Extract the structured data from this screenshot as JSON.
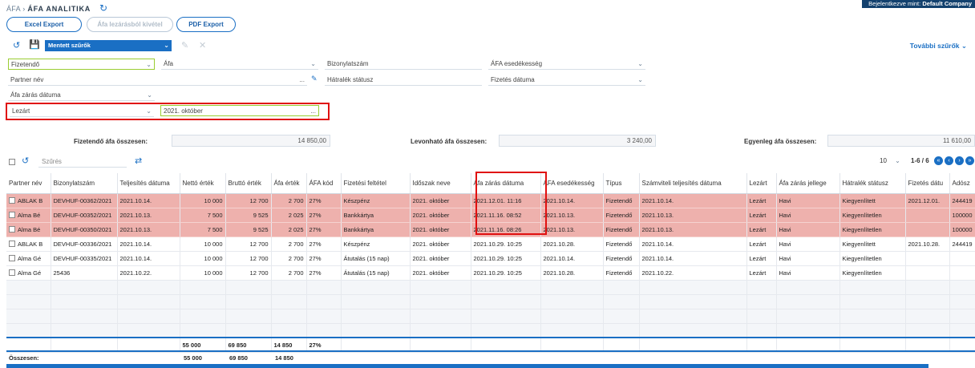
{
  "breadcrumb": {
    "parent": "ÁFA",
    "sep": "›",
    "title": "ÁFA ANALITIKA"
  },
  "login": {
    "prefix": "Bejelentkezve mint:",
    "company": "Default Company"
  },
  "toolbar": {
    "excel": "Excel Export",
    "remove": "Áfa lezárásból kivétel",
    "pdf": "PDF Export"
  },
  "saved_filters": "Mentett szűrők",
  "more_filters": "További szűrők",
  "filters": {
    "fizetendo": "Fizetendő",
    "afa": "Áfa",
    "bizonylatszam": "Bizonylatszám",
    "afa_esedekesseg": "ÁFA esedékesség",
    "partner_nev": "Partner név",
    "hatralek": "Hátralék státusz",
    "fizetes_datuma": "Fizetés dátuma",
    "afa_zaras_datuma": "Áfa zárás dátuma",
    "lezart": "Lezárt",
    "period": "2021. október",
    "dots": "..."
  },
  "totals": {
    "fizetendo_label": "Fizetendő áfa összesen:",
    "fizetendo_value": "14 850,00",
    "levonhato_label": "Levonható áfa összesen:",
    "levonhato_value": "3 240,00",
    "egyenleg_label": "Egyenleg áfa összesen:",
    "egyenleg_value": "11 610,00"
  },
  "search_placeholder": "Szűrés",
  "pager": {
    "page_size": "10",
    "range": "1-6 / 6"
  },
  "columns": [
    "Partner név",
    "Bizonylatszám",
    "Teljesítés dátuma",
    "Nettó érték",
    "Bruttó érték",
    "Áfa érték",
    "ÁFA kód",
    "Fizetési feltétel",
    "Időszak neve",
    "Áfa zárás dátuma",
    "ÁFA esedékesség",
    "Típus",
    "Számviteli teljesítés dátuma",
    "Lezárt",
    "Áfa zárás jellege",
    "Hátralék státusz",
    "Fizetés dátu",
    "Adósz"
  ],
  "rows": [
    [
      "ABLAK B",
      "DEVHUF-00362/2021",
      "2021.10.14.",
      "10 000",
      "12 700",
      "2 700",
      "27%",
      "Készpénz",
      "2021. október",
      "2021.12.01. 11:16",
      "2021.10.14.",
      "Fizetendő",
      "2021.10.14.",
      "Lezárt",
      "Havi",
      "Kiegyenlített",
      "2021.12.01.",
      "244419"
    ],
    [
      "Alma Bé",
      "DEVHUF-00352/2021",
      "2021.10.13.",
      "7 500",
      "9 525",
      "2 025",
      "27%",
      "Bankkártya",
      "2021. október",
      "2021.11.16. 08:52",
      "2021.10.13.",
      "Fizetendő",
      "2021.10.13.",
      "Lezárt",
      "Havi",
      "Kiegyenlítetlen",
      "",
      "100000"
    ],
    [
      "Alma Bé",
      "DEVHUF-00350/2021",
      "2021.10.13.",
      "7 500",
      "9 525",
      "2 025",
      "27%",
      "Bankkártya",
      "2021. október",
      "2021.11.16. 08:26",
      "2021.10.13.",
      "Fizetendő",
      "2021.10.13.",
      "Lezárt",
      "Havi",
      "Kiegyenlítetlen",
      "",
      "100000"
    ],
    [
      "ABLAK B",
      "DEVHUF-00336/2021",
      "2021.10.14.",
      "10 000",
      "12 700",
      "2 700",
      "27%",
      "Készpénz",
      "2021. október",
      "2021.10.29. 10:25",
      "2021.10.28.",
      "Fizetendő",
      "2021.10.14.",
      "Lezárt",
      "Havi",
      "Kiegyenlített",
      "2021.10.28.",
      "244419"
    ],
    [
      "Alma Gé",
      "DEVHUF-00335/2021",
      "2021.10.14.",
      "10 000",
      "12 700",
      "2 700",
      "27%",
      "Átutalás (15 nap)",
      "2021. október",
      "2021.10.29. 10:25",
      "2021.10.14.",
      "Fizetendő",
      "2021.10.14.",
      "Lezárt",
      "Havi",
      "Kiegyenlítetlen",
      "",
      ""
    ],
    [
      "Alma Gé",
      "25436",
      "2021.10.22.",
      "10 000",
      "12 700",
      "2 700",
      "27%",
      "Átutalás (15 nap)",
      "2021. október",
      "2021.10.29. 10:25",
      "2021.10.28.",
      "Fizetendő",
      "2021.10.22.",
      "Lezárt",
      "Havi",
      "Kiegyenlítetlen",
      "",
      ""
    ]
  ],
  "page_sum": {
    "netto": "55 000",
    "brutto": "69 850",
    "afa": "14 850",
    "kod": "27%"
  },
  "grand_sum": {
    "label": "Összesen:",
    "netto": "55 000",
    "brutto": "69 850",
    "afa": "14 850"
  }
}
